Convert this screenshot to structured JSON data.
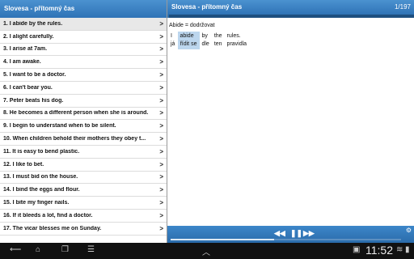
{
  "left_panel": {
    "title": "Slovesa - přítomný čas",
    "items": [
      {
        "label": "1. I abide by the rules.",
        "active": true
      },
      {
        "label": "2. I alight carefully."
      },
      {
        "label": "3. I arise at 7am."
      },
      {
        "label": "4. I am awake."
      },
      {
        "label": "5. I want to be a doctor."
      },
      {
        "label": "6. I can't bear you."
      },
      {
        "label": "7. Peter beats his dog."
      },
      {
        "label": "8. He becomes a different person when she is around."
      },
      {
        "label": "9. I begin to understand when to be silent."
      },
      {
        "label": "10. When children behold their mothers they obey t..."
      },
      {
        "label": "11. It is easy to bend plastic."
      },
      {
        "label": "12. I like to bet."
      },
      {
        "label": "13. I must bid on the house."
      },
      {
        "label": "14. I bind the eggs and flour."
      },
      {
        "label": "15. I bite my finger nails."
      },
      {
        "label": "16. If it bleeds a lot, find a doctor."
      },
      {
        "label": "17. The vicar blesses me on Sunday."
      }
    ],
    "chevron": ">"
  },
  "right_panel": {
    "title": "Slovesa - přítomný čas",
    "counter": "1/197",
    "headword": "Abide = dodržovat",
    "words": [
      {
        "en": "I",
        "cz": "já",
        "highlight": false
      },
      {
        "en": "abide",
        "cz": "řídit se",
        "highlight": true
      },
      {
        "en": "by",
        "cz": "dle",
        "highlight": false
      },
      {
        "en": "the",
        "cz": "ten",
        "highlight": false
      },
      {
        "en": "rules.",
        "cz": "pravidla",
        "highlight": false
      }
    ],
    "progress_fraction": 0.006
  },
  "player": {
    "rewind_icon": "◀◀",
    "pause_icon": "❚❚",
    "forward_icon": "▶▶",
    "gear_icon": "⚙",
    "position_fraction": 0.45
  },
  "system_bar": {
    "time": "11:52",
    "icons": [
      "back-icon",
      "home-icon",
      "recent-apps-icon",
      "screenshot-icon",
      "up-icon",
      "notification-icon",
      "wifi-icon",
      "battery-icon"
    ]
  }
}
